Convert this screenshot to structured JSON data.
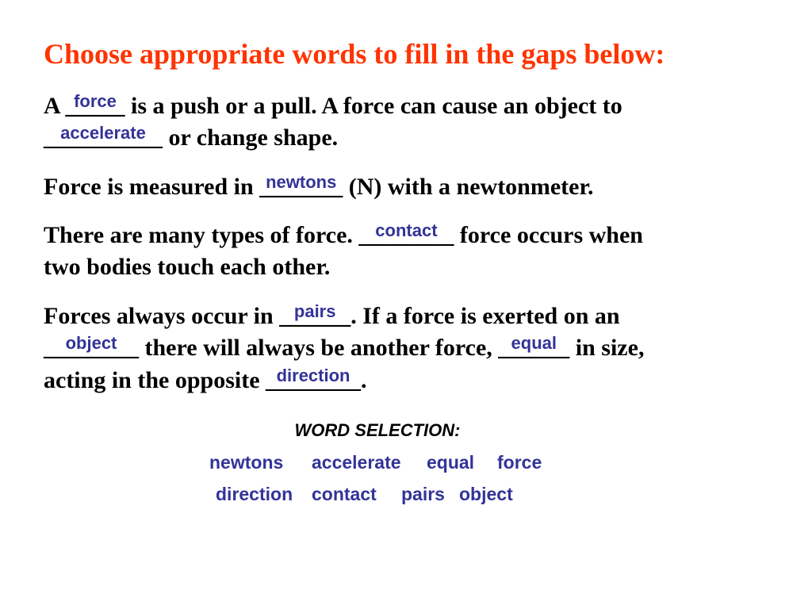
{
  "title": "Choose appropriate words to fill in the gaps below:",
  "colors": {
    "title": "#ff3300",
    "body": "#000000",
    "answer": "#333399"
  },
  "paragraphs": {
    "p1": {
      "l1_a": "A ",
      "blank1": {
        "underscores": "_____",
        "answer": "force"
      },
      "l1_b": " is a push or a pull. A force can cause an object to",
      "blank2": {
        "underscores": "__________",
        "answer": "accelerate"
      },
      "l2_b": " or change shape."
    },
    "p2": {
      "a": "Force is measured in ",
      "blank": {
        "underscores": "_______",
        "answer": "newtons"
      },
      "b": " (N) with a newtonmeter."
    },
    "p3": {
      "a": "There are many types of force. ",
      "blank": {
        "underscores": "________",
        "answer": "contact"
      },
      "b": " force occurs when",
      "c": "two bodies touch each other."
    },
    "p4": {
      "a": "Forces always occur in ",
      "blank1": {
        "underscores": "______",
        "answer": "pairs"
      },
      "b": ". If a force is exerted on an",
      "blank2": {
        "underscores": "________",
        "answer": "object"
      },
      "c": " there will always be another force, ",
      "blank3": {
        "underscores": "______",
        "answer": "equal"
      },
      "d": " in size,",
      "e": "acting in the opposite ",
      "blank4": {
        "underscores": "________",
        "answer": "direction"
      },
      "f": "."
    }
  },
  "word_selection": {
    "heading": "WORD SELECTION:",
    "row1": [
      "newtons",
      "accelerate",
      "equal",
      "force"
    ],
    "row2": [
      "direction",
      "contact",
      "pairs",
      "object"
    ]
  }
}
